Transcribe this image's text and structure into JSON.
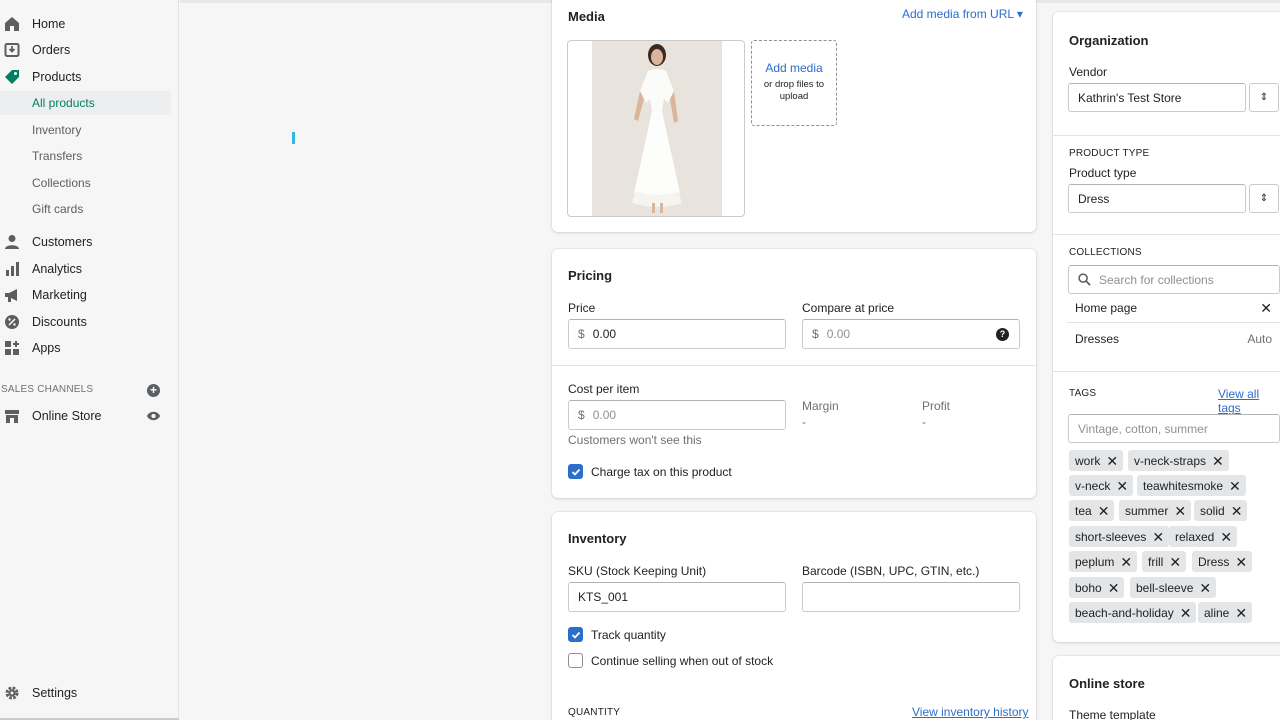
{
  "sidebar": {
    "items": [
      {
        "label": "Home",
        "icon": "home-icon"
      },
      {
        "label": "Orders",
        "icon": "orders-icon"
      },
      {
        "label": "Products",
        "icon": "tag-icon"
      },
      {
        "label": "Customers",
        "icon": "person-icon"
      },
      {
        "label": "Analytics",
        "icon": "bar-chart-icon"
      },
      {
        "label": "Marketing",
        "icon": "megaphone-icon"
      },
      {
        "label": "Discounts",
        "icon": "discount-icon"
      },
      {
        "label": "Apps",
        "icon": "apps-icon"
      }
    ],
    "product_sub": [
      "All products",
      "Inventory",
      "Transfers",
      "Collections",
      "Gift cards"
    ],
    "sales_channels_label": "SALES CHANNELS",
    "online_store": "Online Store",
    "settings": "Settings",
    "accent": "#008060"
  },
  "media": {
    "title": "Media",
    "add_from_url": "Add media from URL ▾",
    "add_media": "Add media",
    "drop_hint": "or drop files to upload"
  },
  "pricing": {
    "title": "Pricing",
    "price_label": "Price",
    "price_value": "0.00",
    "compare_label": "Compare at price",
    "compare_value": "0.00",
    "currency": "$",
    "cost_label": "Cost per item",
    "cost_value": "0.00",
    "cost_help": "Customers won't see this",
    "margin_label": "Margin",
    "margin_value": "-",
    "profit_label": "Profit",
    "profit_value": "-",
    "charge_tax": "Charge tax on this product",
    "charge_tax_checked": true
  },
  "inventory": {
    "title": "Inventory",
    "sku_label": "SKU (Stock Keeping Unit)",
    "sku_value": "KTS_001",
    "barcode_label": "Barcode (ISBN, UPC, GTIN, etc.)",
    "barcode_value": "",
    "track_qty": "Track quantity",
    "track_qty_checked": true,
    "continue_selling": "Continue selling when out of stock",
    "continue_selling_checked": false,
    "quantity_label": "QUANTITY",
    "view_history": "View inventory history"
  },
  "organization": {
    "title": "Organization",
    "vendor_label": "Vendor",
    "vendor_value": "Kathrin's Test Store",
    "product_type_caps": "PRODUCT TYPE",
    "product_type_label": "Product type",
    "product_type_value": "Dress",
    "collections_caps": "COLLECTIONS",
    "collections_placeholder": "Search for collections",
    "collections": [
      {
        "name": "Home page",
        "right": "✕"
      },
      {
        "name": "Dresses",
        "right": "Auto"
      }
    ],
    "tags_caps": "TAGS",
    "view_all_tags": "View all tags",
    "tags_placeholder": "Vintage, cotton, summer",
    "tags": [
      "work",
      "v-neck-straps",
      "v-neck",
      "teawhitesmoke",
      "tea",
      "summer",
      "solid",
      "short-sleeves",
      "relaxed",
      "peplum",
      "frill",
      "Dress",
      "boho",
      "bell-sleeve",
      "beach-and-holiday",
      "aline"
    ]
  },
  "online_store_card": {
    "title": "Online store",
    "theme_template": "Theme template"
  }
}
